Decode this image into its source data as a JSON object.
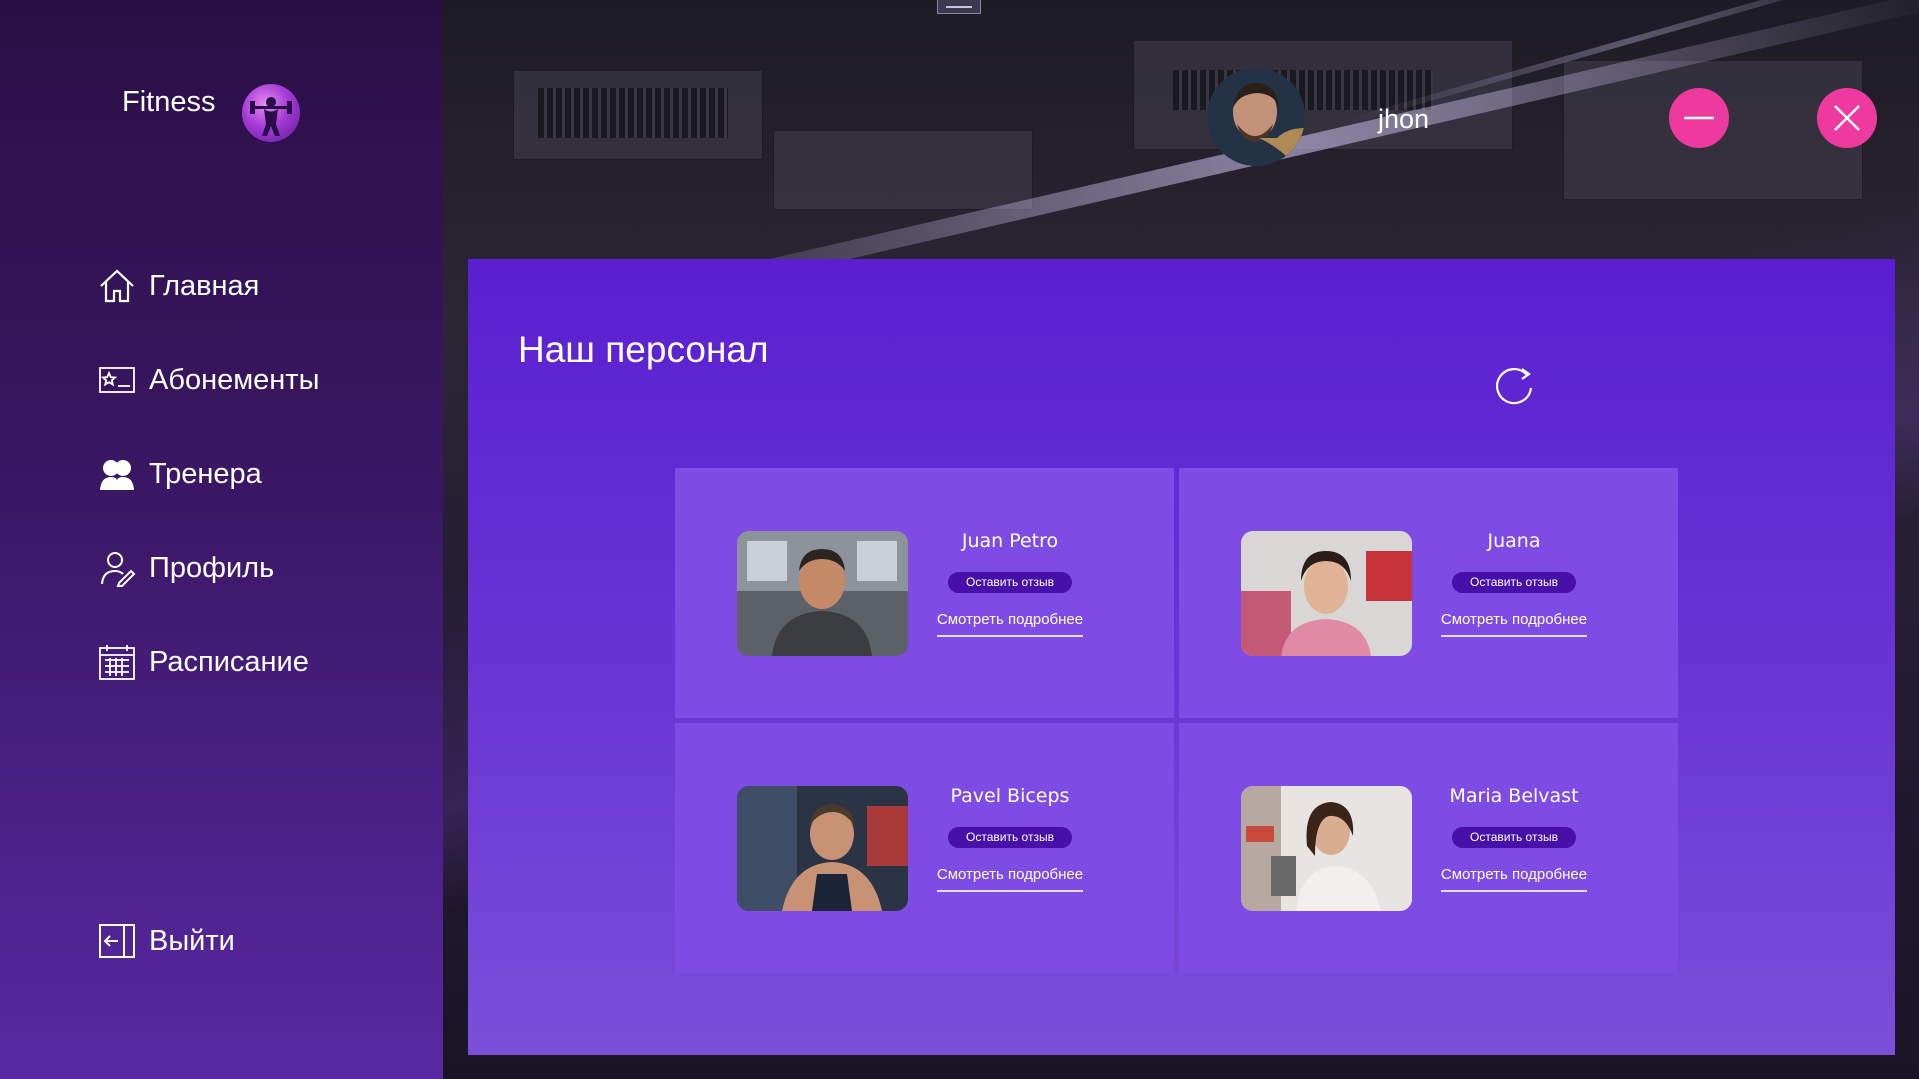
{
  "app": {
    "brand_name": "Fitness"
  },
  "sidebar": {
    "items": [
      {
        "label": "Главная",
        "icon": "home-icon"
      },
      {
        "label": "Абонементы",
        "icon": "membership-card-icon"
      },
      {
        "label": "Тренера",
        "icon": "trainers-icon"
      },
      {
        "label": "Профиль",
        "icon": "profile-icon"
      },
      {
        "label": "Расписание",
        "icon": "calendar-icon"
      }
    ],
    "logout": {
      "label": "Выйти",
      "icon": "logout-icon"
    }
  },
  "header": {
    "user_name": "jhon",
    "minimize_icon": "minus-icon",
    "close_icon": "close-icon"
  },
  "main": {
    "title": "Наш персонал",
    "refresh_icon": "refresh-icon",
    "staff": [
      {
        "name": "Juan Petro",
        "review_label": "Оставить отзыв",
        "details_label": "Смотреть подробнее"
      },
      {
        "name": "Juana",
        "review_label": "Оставить отзыв",
        "details_label": "Смотреть подробнее"
      },
      {
        "name": "Pavel Biceps",
        "review_label": "Оставить отзыв",
        "details_label": "Смотреть подробнее"
      },
      {
        "name": "Maria Belvast",
        "review_label": "Оставить отзыв",
        "details_label": "Смотреть подробнее"
      }
    ]
  },
  "colors": {
    "accent_pink": "#ee3a9f",
    "panel_purple": "#5a1fd0",
    "card_purple": "#7e4be4",
    "review_button": "#4710a8"
  }
}
